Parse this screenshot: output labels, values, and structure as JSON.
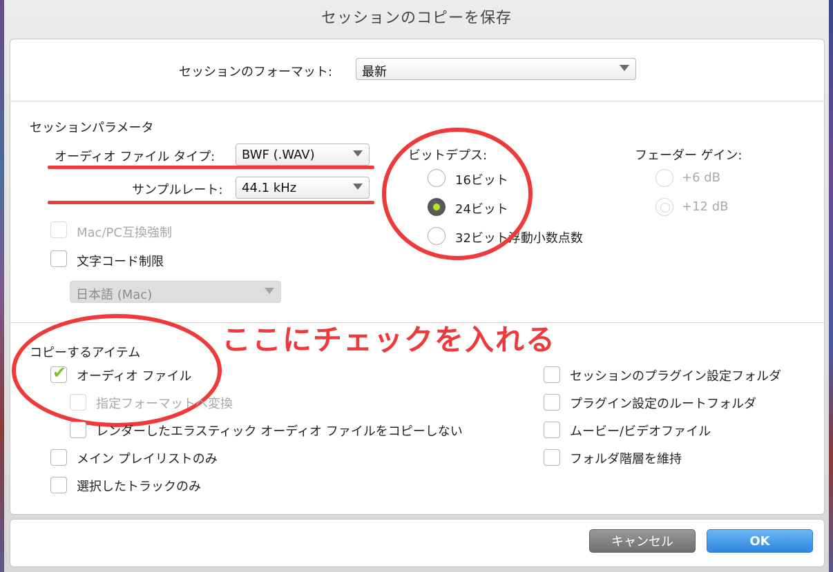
{
  "window": {
    "title": "セッションのコピーを保存"
  },
  "session_format": {
    "label": "セッションのフォーマット:",
    "value": "最新"
  },
  "session_params": {
    "heading": "セッションパラメータ",
    "audio_file_type_label": "オーディオ ファイル タイプ:",
    "audio_file_type_value": "BWF (.WAV)",
    "sample_rate_label": "サンプルレート:",
    "sample_rate_value": "44.1 kHz",
    "mac_pc_label": "Mac/PC互換強制",
    "char_code_label": "文字コード制限",
    "char_code_value": "日本語 (Mac)"
  },
  "bit_depth": {
    "label": "ビットデプス:",
    "options": [
      "16ビット",
      "24ビット",
      "32ビット浮動小数点数"
    ],
    "selected": "24ビット"
  },
  "fader_gain": {
    "label": "フェーダー ゲイン:",
    "options": [
      "+6 dB",
      "+12 dB"
    ]
  },
  "annotation": {
    "text": "ここにチェックを入れる",
    "color": "#ee3a3a"
  },
  "copy_items": {
    "heading": "コピーするアイテム",
    "audio_files": "オーディオ ファイル",
    "convert_format": "指定フォーマットへ変換",
    "no_rendered_elastic": "レンダーしたエラスティック オーディオ ファイルをコピーしない",
    "main_playlist_only": "メイン プレイリストのみ",
    "selected_tracks_only": "選択したトラックのみ",
    "plugin_settings_folder": "セッションのプラグイン設定フォルダ",
    "plugin_root_folder": "プラグイン設定のルートフォルダ",
    "movie_video_files": "ムービー/ビデオファイル",
    "keep_folder_hierarchy": "フォルダ階層を維持"
  },
  "buttons": {
    "cancel": "キャンセル",
    "ok": "OK"
  },
  "colors": {
    "accent_check": "#7cc622",
    "ok_button": "#2f86e0",
    "annotation": "#ee3a3a"
  }
}
